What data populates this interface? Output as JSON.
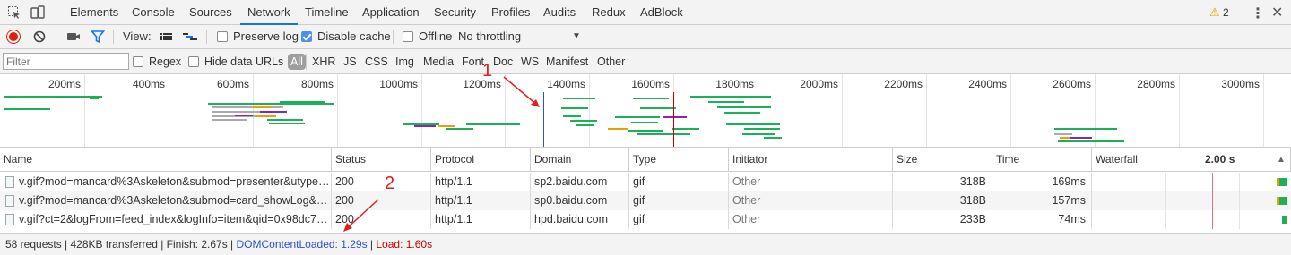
{
  "tabs": [
    {
      "label": "Elements",
      "active": false
    },
    {
      "label": "Console",
      "active": false
    },
    {
      "label": "Sources",
      "active": false
    },
    {
      "label": "Network",
      "active": true
    },
    {
      "label": "Timeline",
      "active": false
    },
    {
      "label": "Application",
      "active": false
    },
    {
      "label": "Security",
      "active": false
    },
    {
      "label": "Profiles",
      "active": false
    },
    {
      "label": "Audits",
      "active": false
    },
    {
      "label": "Redux",
      "active": false
    },
    {
      "label": "AdBlock",
      "active": false
    }
  ],
  "warnings": {
    "count": "2",
    "icon": "warning-icon"
  },
  "toolbar": {
    "view_label": "View:",
    "preserve_log": {
      "label": "Preserve log",
      "checked": false
    },
    "disable_cache": {
      "label": "Disable cache",
      "checked": true
    },
    "offline": {
      "label": "Offline",
      "checked": false
    },
    "throttling": "No throttling"
  },
  "filter": {
    "placeholder": "Filter",
    "regex": {
      "label": "Regex",
      "checked": false
    },
    "hide_data_urls": {
      "label": "Hide data URLs",
      "checked": false
    },
    "types": [
      "All",
      "XHR",
      "JS",
      "CSS",
      "Img",
      "Media",
      "Font",
      "Doc",
      "WS",
      "Manifest",
      "Other"
    ]
  },
  "overview": {
    "ticks": [
      "200ms",
      "400ms",
      "600ms",
      "800ms",
      "1000ms",
      "1200ms",
      "1400ms",
      "1600ms",
      "1800ms",
      "2000ms",
      "2200ms",
      "2400ms",
      "2600ms",
      "2800ms",
      "3000ms"
    ],
    "dom_content_loaded_ms": 1290,
    "load_ms": 1600
  },
  "table": {
    "columns": [
      "Name",
      "Status",
      "Protocol",
      "Domain",
      "Type",
      "Initiator",
      "Size",
      "Time",
      "Waterfall"
    ],
    "waterfall_scale": "2.00 s",
    "rows": [
      {
        "name": "v.gif?mod=mancard%3Askeleton&submod=presenter&utype=...",
        "status": "200",
        "protocol": "http/1.1",
        "domain": "sp2.baidu.com",
        "type": "gif",
        "initiator": "Other",
        "size": "318B",
        "time": "169ms"
      },
      {
        "name": "v.gif?mod=mancard%3Askeleton&submod=card_showLog&u...",
        "status": "200",
        "protocol": "http/1.1",
        "domain": "sp0.baidu.com",
        "type": "gif",
        "initiator": "Other",
        "size": "318B",
        "time": "157ms"
      },
      {
        "name": "v.gif?ct=2&logFrom=feed_index&logInfo=item&qid=0x98dc7a...",
        "status": "200",
        "protocol": "http/1.1",
        "domain": "hpd.baidu.com",
        "type": "gif",
        "initiator": "Other",
        "size": "233B",
        "time": "74ms"
      }
    ]
  },
  "status": {
    "summary": "58 requests | 428KB transferred | Finish: 2.67s | ",
    "dcl": "DOMContentLoaded: 1.29s",
    "sep": " | ",
    "load": "Load: 1.60s"
  },
  "annotations": [
    "1",
    "2"
  ],
  "colors": {
    "dcl_line": "#2a53cd",
    "load_line": "#c80000",
    "accent": "#1a73e8"
  }
}
